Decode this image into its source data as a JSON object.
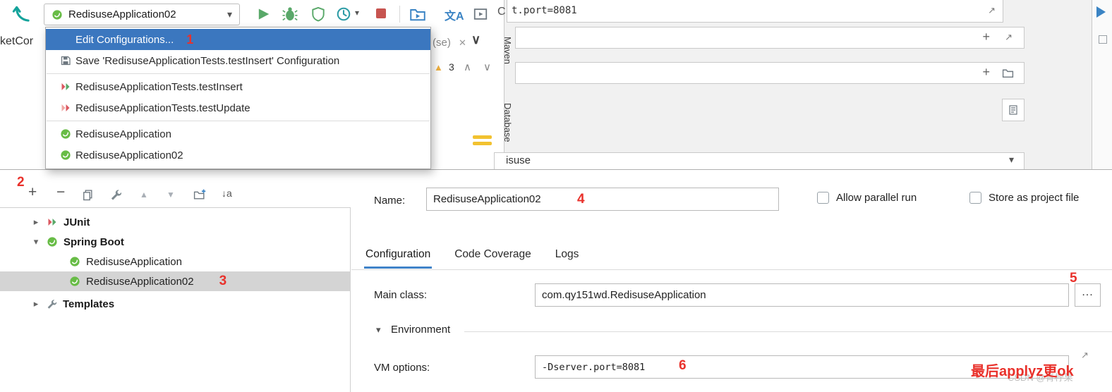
{
  "colors": {
    "selection_blue": "#3B77BF",
    "tab_accent": "#4083C9",
    "annotation_red": "#E9312B",
    "spring_green": "#68BC46",
    "run_green": "#59A869",
    "stop_red": "#C75450"
  },
  "toolbar": {
    "run_config_value": "RedisuseApplication02",
    "translate_label": "文A",
    "overflow_fragment": "C"
  },
  "editor": {
    "tab_fragment": "ketCor",
    "combo_fragment": "(se)",
    "match_count": "3",
    "top_field_fragment": "t.port=8081",
    "module_combo_fragment": "isuse"
  },
  "tool_windows": {
    "maven": "Maven",
    "database": "Database"
  },
  "run_menu": {
    "items": [
      {
        "label": "Edit Configurations...",
        "annotation": "1"
      },
      {
        "label": "Save 'RedisuseApplicationTests.testInsert' Configuration"
      },
      {
        "label": "RedisuseApplicationTests.testInsert"
      },
      {
        "label": "RedisuseApplicationTests.testUpdate"
      },
      {
        "label": "RedisuseApplication"
      },
      {
        "label": "RedisuseApplication02"
      }
    ]
  },
  "dialog": {
    "toolbar_annotation": "2",
    "tree": {
      "items": [
        {
          "label": "JUnit"
        },
        {
          "label": "Spring Boot"
        },
        {
          "label": "RedisuseApplication"
        },
        {
          "label": "RedisuseApplication02",
          "annotation": "3"
        },
        {
          "label": "Templates"
        }
      ]
    },
    "name_label": "Name:",
    "name_value": "RedisuseApplication02",
    "name_annotation": "4",
    "allow_parallel_run": "Allow parallel run",
    "store_as_project_file": "Store as project file",
    "tabs": [
      {
        "label": "Configuration"
      },
      {
        "label": "Code Coverage"
      },
      {
        "label": "Logs"
      }
    ],
    "main_class_label": "Main class:",
    "main_class_value": "com.qy151wd.RedisuseApplication",
    "browse_button": "...",
    "browse_annotation": "5",
    "environment_label": "Environment",
    "vm_options_label": "VM options:",
    "vm_options_value": "-Dserver.port=8081",
    "vm_annotation": "6",
    "note": "最后applyz更ok",
    "watermark": "CSDN @青柠果"
  },
  "icons": {
    "caret_down": "▾",
    "chevron_up": "∧",
    "chevron_down": "∨",
    "close": "✕",
    "plus": "+",
    "minus": "−",
    "up": "▲",
    "down": "▼",
    "expand": "↗",
    "sort": "↓a",
    "tree_collapsed": "▸",
    "tree_expanded": "▾",
    "section_expanded": "▾",
    "warning": "▲"
  }
}
